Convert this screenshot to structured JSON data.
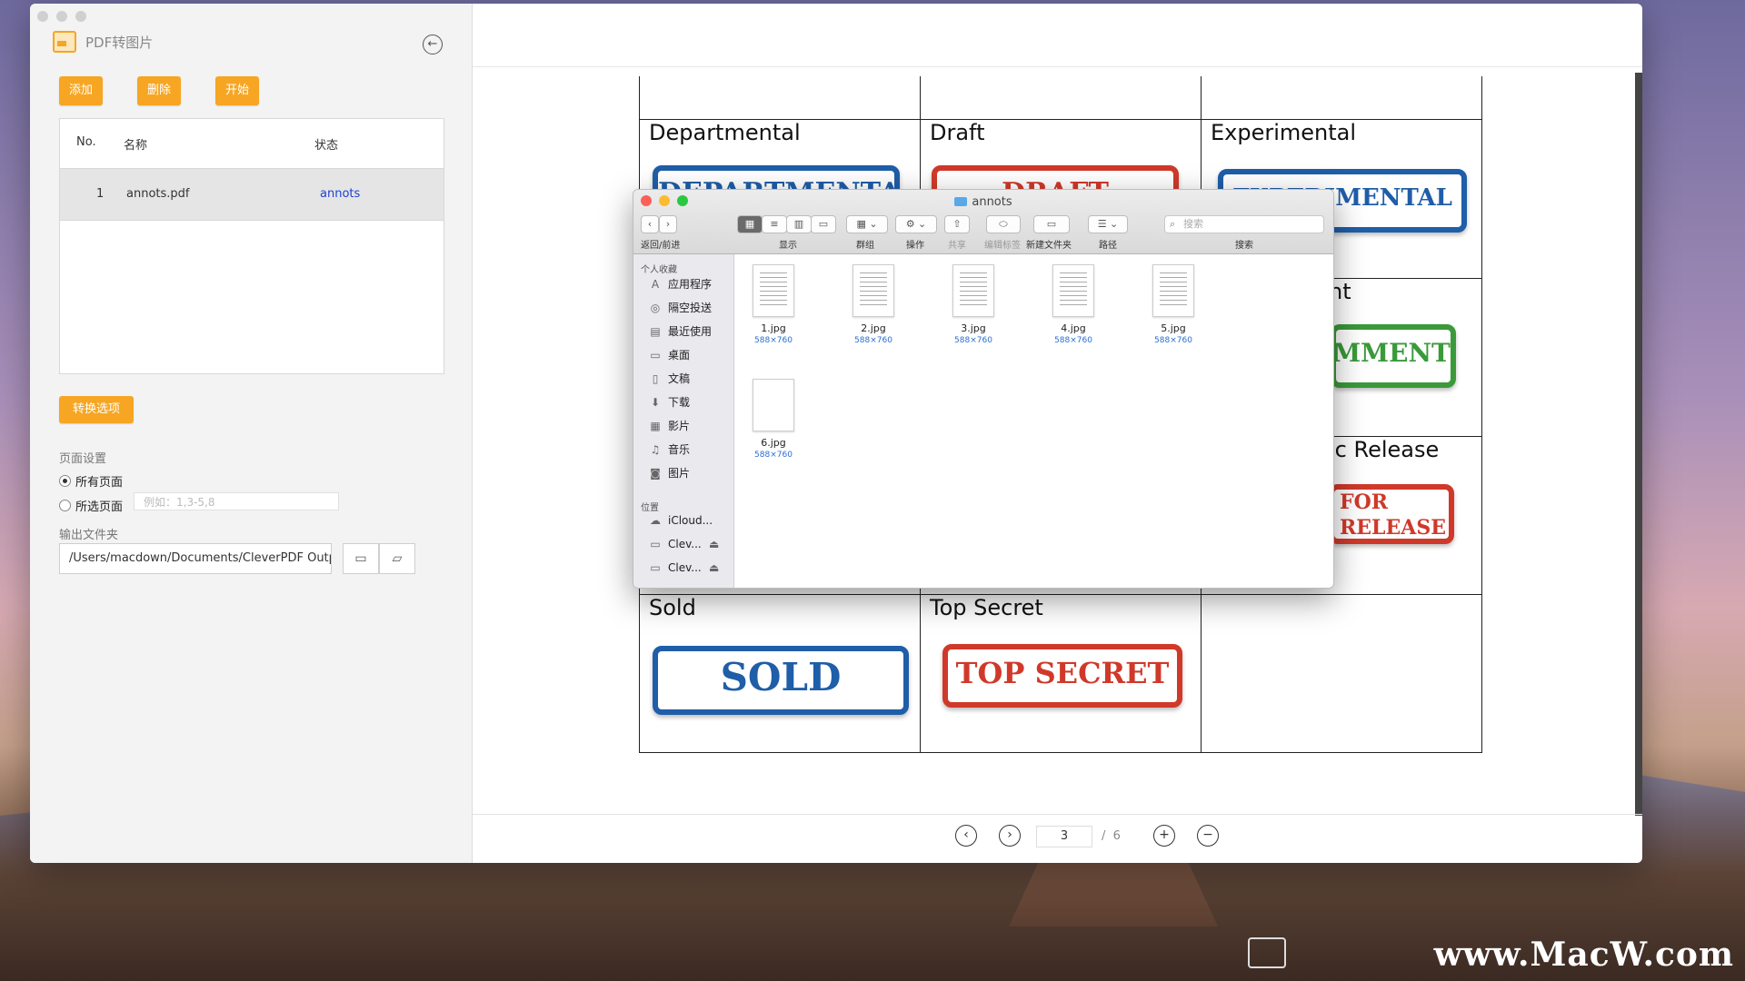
{
  "app": {
    "title": "PDF转图片",
    "buttons": {
      "add": "添加",
      "delete": "删除",
      "start": "开始",
      "options": "转换选项"
    },
    "table": {
      "headers": {
        "no": "No.",
        "name": "名称",
        "status": "状态"
      },
      "rows": [
        {
          "no": "1",
          "name": "annots.pdf",
          "status": "annots"
        }
      ]
    },
    "page_settings": {
      "label": "页面设置",
      "all_pages": "所有页面",
      "selected_pages": "所选页面",
      "range_placeholder": "例如：1,3-5,8"
    },
    "output": {
      "label": "输出文件夹",
      "path": "/Users/macdown/Documents/CleverPDF Outp"
    }
  },
  "viewer": {
    "page_current": "3",
    "page_separator": "/",
    "page_total": "6",
    "cells": [
      {
        "title": "Departmental",
        "stamp": "DEPARTMENTAL",
        "color": "blue"
      },
      {
        "title": "Draft",
        "stamp": "DRAFT",
        "color": "red"
      },
      {
        "title": "Experimental",
        "stamp": "EXPERIMENTAL",
        "color": "blue"
      },
      {
        "title": "nt",
        "stamp": "MMENT",
        "color": "green"
      },
      {
        "title": "ic Release",
        "stamp": "FOR RELEASE",
        "color": "red"
      },
      {
        "title": "Sold",
        "stamp": "SOLD",
        "color": "blue"
      },
      {
        "title": "Top Secret",
        "stamp": "TOP SECRET",
        "color": "red"
      }
    ]
  },
  "finder": {
    "title": "annots",
    "toolbar_labels": {
      "back_forward": "返回/前进",
      "view": "显示",
      "group": "群组",
      "action": "操作",
      "share": "共享",
      "tags": "编辑标签",
      "new_folder": "新建文件夹",
      "path": "路径",
      "search": "搜索"
    },
    "search_placeholder": "搜索",
    "favorites_label": "个人收藏",
    "favorites": [
      "应用程序",
      "隔空投送",
      "最近使用",
      "桌面",
      "文稿",
      "下载",
      "影片",
      "音乐",
      "图片"
    ],
    "locations_label": "位置",
    "locations": [
      "iCloud...",
      "Clev...",
      "Clev..."
    ],
    "files": [
      {
        "name": "1.jpg",
        "dims": "588×760"
      },
      {
        "name": "2.jpg",
        "dims": "588×760"
      },
      {
        "name": "3.jpg",
        "dims": "588×760"
      },
      {
        "name": "4.jpg",
        "dims": "588×760"
      },
      {
        "name": "5.jpg",
        "dims": "588×760"
      },
      {
        "name": "6.jpg",
        "dims": "588×760"
      }
    ]
  },
  "watermark": "www.MacW.com",
  "colors": {
    "accent": "#f6a623",
    "status_link": "#1c3fd9"
  }
}
